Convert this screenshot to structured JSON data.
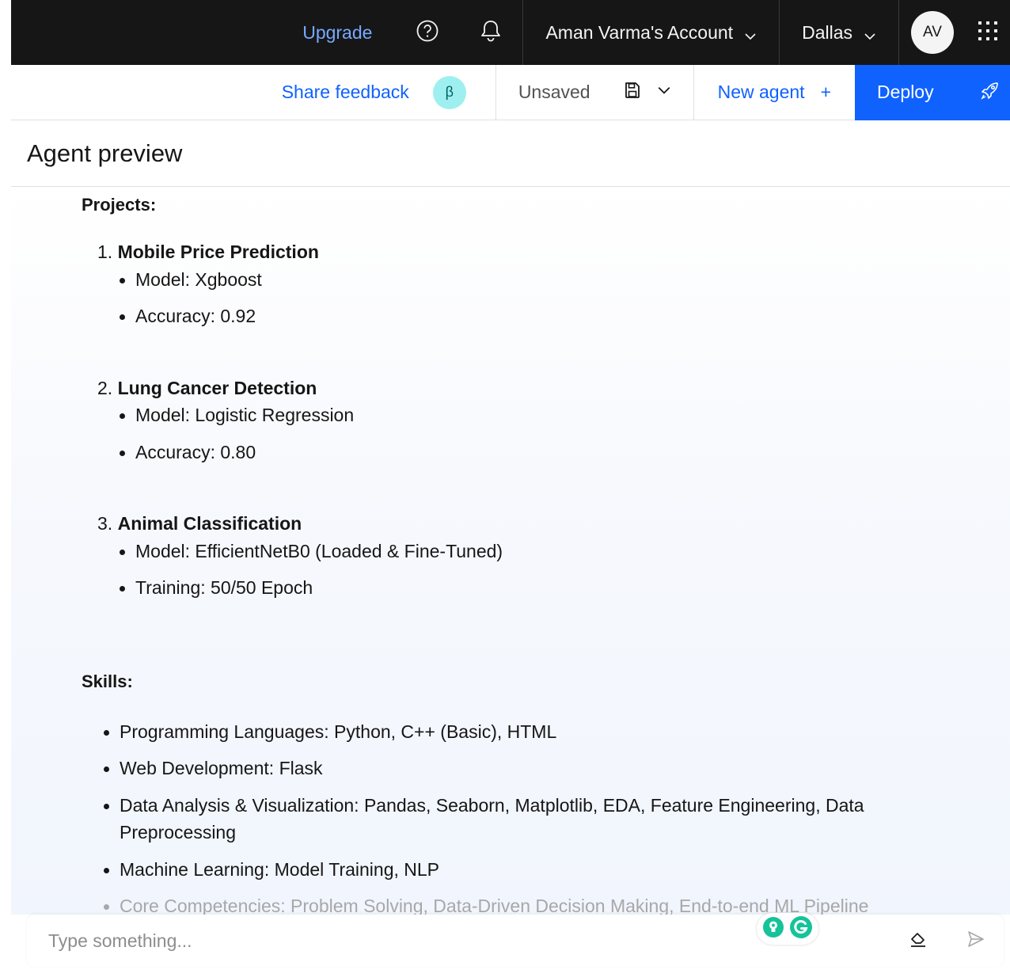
{
  "topbar": {
    "upgrade_label": "Upgrade",
    "account_label": "Aman Varma's Account",
    "region_label": "Dallas",
    "avatar_initials": "AV"
  },
  "toolbar": {
    "feedback_label": "Share feedback",
    "beta_badge": "β",
    "status_label": "Unsaved",
    "new_agent_label": "New agent",
    "new_agent_plus": "+",
    "deploy_label": "Deploy"
  },
  "panel": {
    "title": "Agent preview"
  },
  "content": {
    "projects_heading": "Projects:",
    "projects": [
      {
        "number": "1.",
        "title": "Mobile Price Prediction",
        "details": [
          "Model: Xgboost",
          "Accuracy: 0.92"
        ]
      },
      {
        "number": "2.",
        "title": "Lung Cancer Detection",
        "details": [
          "Model: Logistic Regression",
          "Accuracy: 0.80"
        ]
      },
      {
        "number": "3.",
        "title": "Animal Classification",
        "details": [
          "Model: EfficientNetB0 (Loaded & Fine-Tuned)",
          "Training: 50/50 Epoch"
        ]
      }
    ],
    "skills_heading": "Skills:",
    "skills": [
      "Programming Languages: Python, C++ (Basic), HTML",
      "Web Development: Flask",
      "Data Analysis & Visualization: Pandas, Seaborn, Matplotlib, EDA, Feature Engineering, Data Preprocessing",
      "Machine Learning: Model Training, NLP",
      "Core Competencies: Problem Solving, Data-Driven Decision Making, End-to-end ML Pipeline"
    ]
  },
  "input": {
    "placeholder": "Type something..."
  },
  "icons": {
    "help": "help-icon",
    "notification": "notification-icon",
    "save": "save-icon",
    "deploy": "rocket-icon",
    "switcher": "app-switcher-icon",
    "eraser": "eraser-icon",
    "send": "send-icon"
  },
  "colors": {
    "topbar_bg": "#161616",
    "link_blue": "#78a9ff",
    "primary_blue": "#0f62fe",
    "beta_bg": "#9ef0f0",
    "grammarly_green": "#15c39a"
  }
}
